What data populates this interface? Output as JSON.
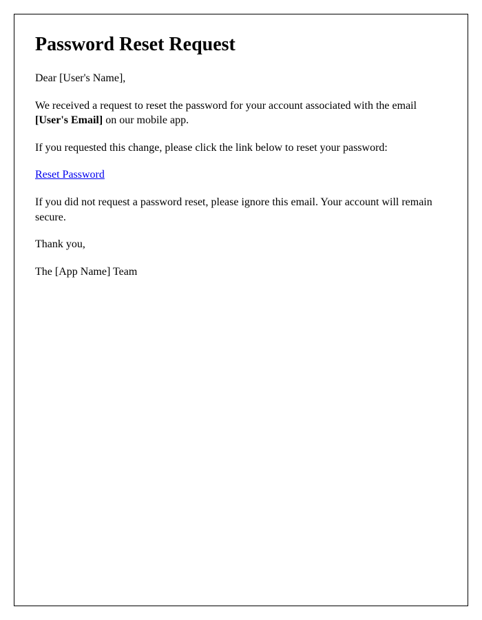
{
  "title": "Password Reset Request",
  "greeting_prefix": "Dear ",
  "greeting_name": "[User's Name]",
  "greeting_suffix": ",",
  "intro_prefix": "We received a request to reset the password for your account associated with the email ",
  "user_email": "[User's Email]",
  "intro_suffix": " on our mobile app.",
  "instruction": "If you requested this change, please click the link below to reset your password:",
  "reset_link_text": "Reset Password",
  "ignore_notice": "If you did not request a password reset, please ignore this email. Your account will remain secure.",
  "thank_you": "Thank you,",
  "signature_prefix": "The ",
  "app_name": "[App Name]",
  "signature_suffix": " Team"
}
